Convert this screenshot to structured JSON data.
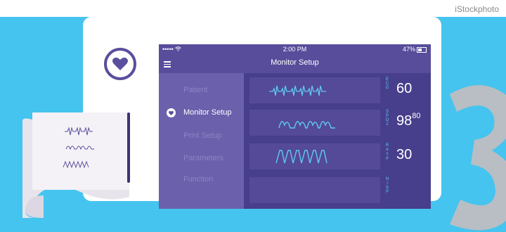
{
  "watermark": "iStockphoto",
  "banner": {
    "big_number": "3",
    "background_color": "#45c4ef"
  },
  "status_bar": {
    "signal": "•••••",
    "time": "2:00 PM",
    "battery": "47%"
  },
  "header": {
    "title": "Monitor Setup"
  },
  "sidebar": {
    "items": [
      {
        "label": "Patient",
        "active": false
      },
      {
        "label": "Monitor Setup",
        "active": true
      },
      {
        "label": "Print Setup",
        "active": false
      },
      {
        "label": "Parameters",
        "active": false
      },
      {
        "label": "Function",
        "active": false
      }
    ]
  },
  "readouts": [
    {
      "label": "ECG",
      "value": "60",
      "sub": ""
    },
    {
      "label": "SPO2",
      "value": "98",
      "sub": "80"
    },
    {
      "label": "Resp",
      "value": "30",
      "sub": ""
    },
    {
      "label": "NibP",
      "value": "",
      "sub": ""
    }
  ],
  "colors": {
    "screen": "#574d9b",
    "sidebar": "#6a60ac",
    "main": "#473e8c",
    "accent": "#5fcbee"
  }
}
